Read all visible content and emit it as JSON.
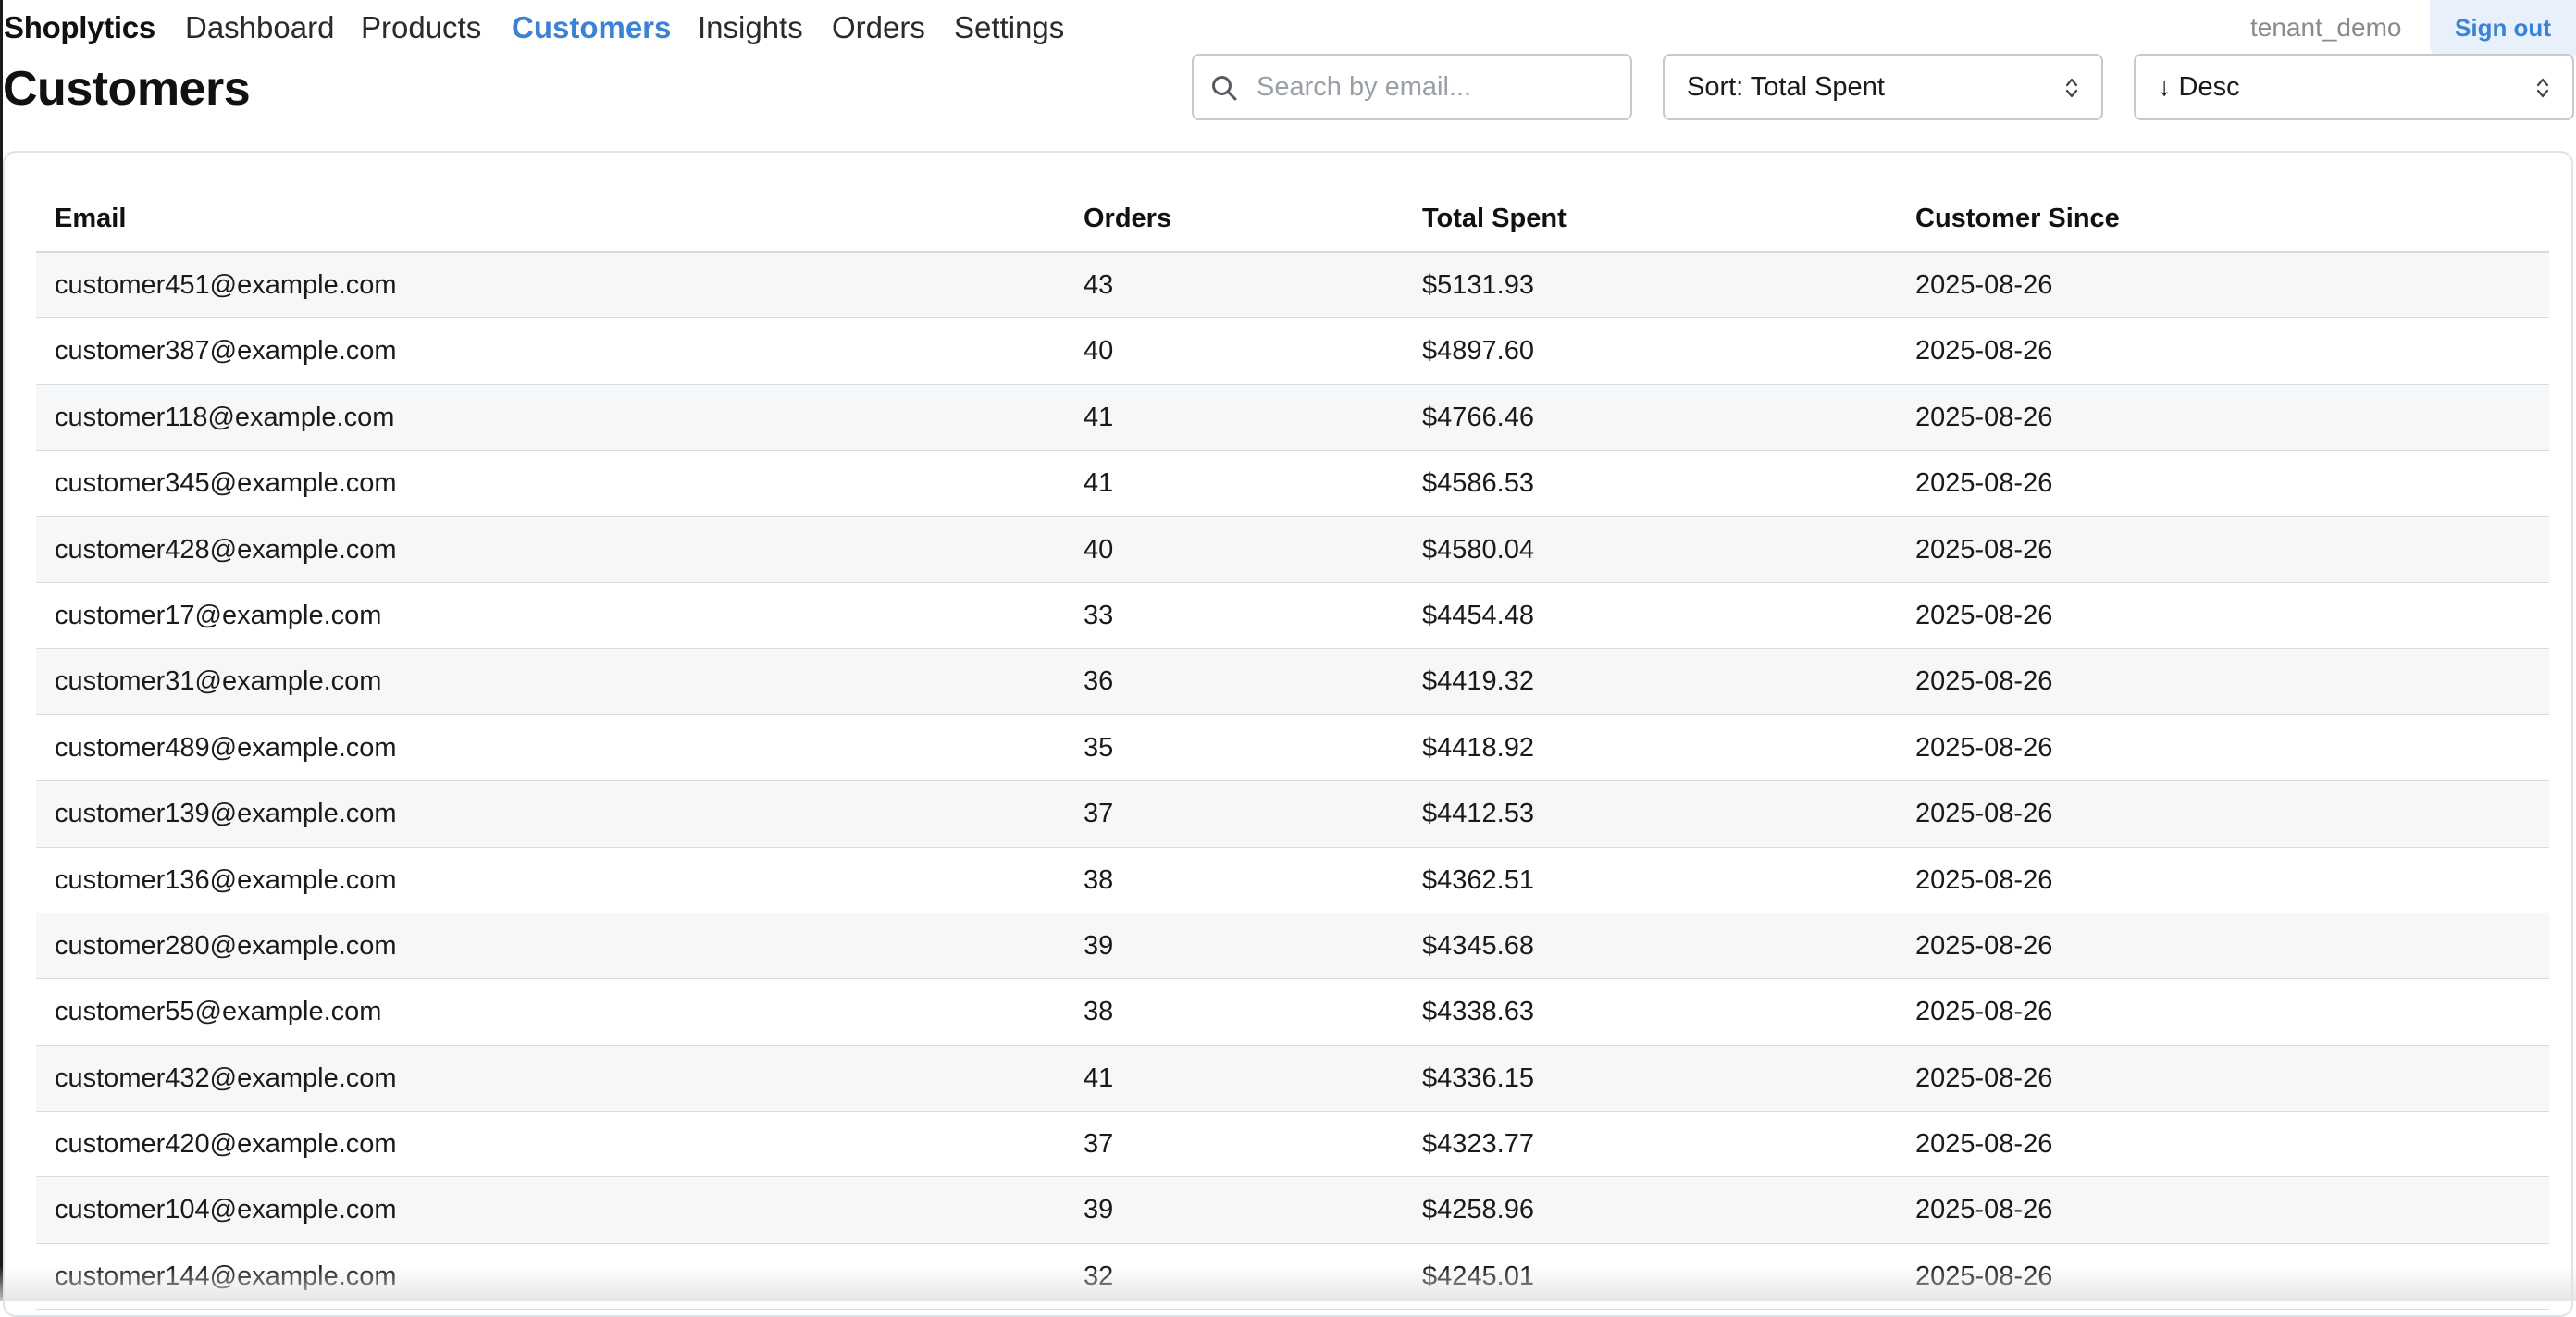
{
  "nav": {
    "brand": "Shoplytics",
    "links": [
      {
        "label": "Dashboard",
        "active": false
      },
      {
        "label": "Products",
        "active": false
      },
      {
        "label": "Customers",
        "active": true
      },
      {
        "label": "Insights",
        "active": false
      },
      {
        "label": "Orders",
        "active": false
      },
      {
        "label": "Settings",
        "active": false
      }
    ],
    "tenant": "tenant_demo",
    "signout_label": "Sign out"
  },
  "page": {
    "title": "Customers"
  },
  "controls": {
    "search_placeholder": "Search by email...",
    "search_value": "",
    "search_icon": "search-icon",
    "sort_label": "Sort: Total Spent",
    "order_label": "↓ Desc",
    "chevron_icon": "select-chevron-icon"
  },
  "table": {
    "columns": [
      "Email",
      "Orders",
      "Total Spent",
      "Customer Since"
    ],
    "rows": [
      [
        "customer451@example.com",
        "43",
        "$5131.93",
        "2025-08-26"
      ],
      [
        "customer387@example.com",
        "40",
        "$4897.60",
        "2025-08-26"
      ],
      [
        "customer118@example.com",
        "41",
        "$4766.46",
        "2025-08-26"
      ],
      [
        "customer345@example.com",
        "41",
        "$4586.53",
        "2025-08-26"
      ],
      [
        "customer428@example.com",
        "40",
        "$4580.04",
        "2025-08-26"
      ],
      [
        "customer17@example.com",
        "33",
        "$4454.48",
        "2025-08-26"
      ],
      [
        "customer31@example.com",
        "36",
        "$4419.32",
        "2025-08-26"
      ],
      [
        "customer489@example.com",
        "35",
        "$4418.92",
        "2025-08-26"
      ],
      [
        "customer139@example.com",
        "37",
        "$4412.53",
        "2025-08-26"
      ],
      [
        "customer136@example.com",
        "38",
        "$4362.51",
        "2025-08-26"
      ],
      [
        "customer280@example.com",
        "39",
        "$4345.68",
        "2025-08-26"
      ],
      [
        "customer55@example.com",
        "38",
        "$4338.63",
        "2025-08-26"
      ],
      [
        "customer432@example.com",
        "41",
        "$4336.15",
        "2025-08-26"
      ],
      [
        "customer420@example.com",
        "37",
        "$4323.77",
        "2025-08-26"
      ],
      [
        "customer104@example.com",
        "39",
        "$4258.96",
        "2025-08-26"
      ],
      [
        "customer144@example.com",
        "32",
        "$4245.01",
        "2025-08-26"
      ]
    ]
  },
  "colors": {
    "accent": "#3b82d4",
    "row_alt": "#f6f7f9",
    "border": "#d9dcdf"
  }
}
